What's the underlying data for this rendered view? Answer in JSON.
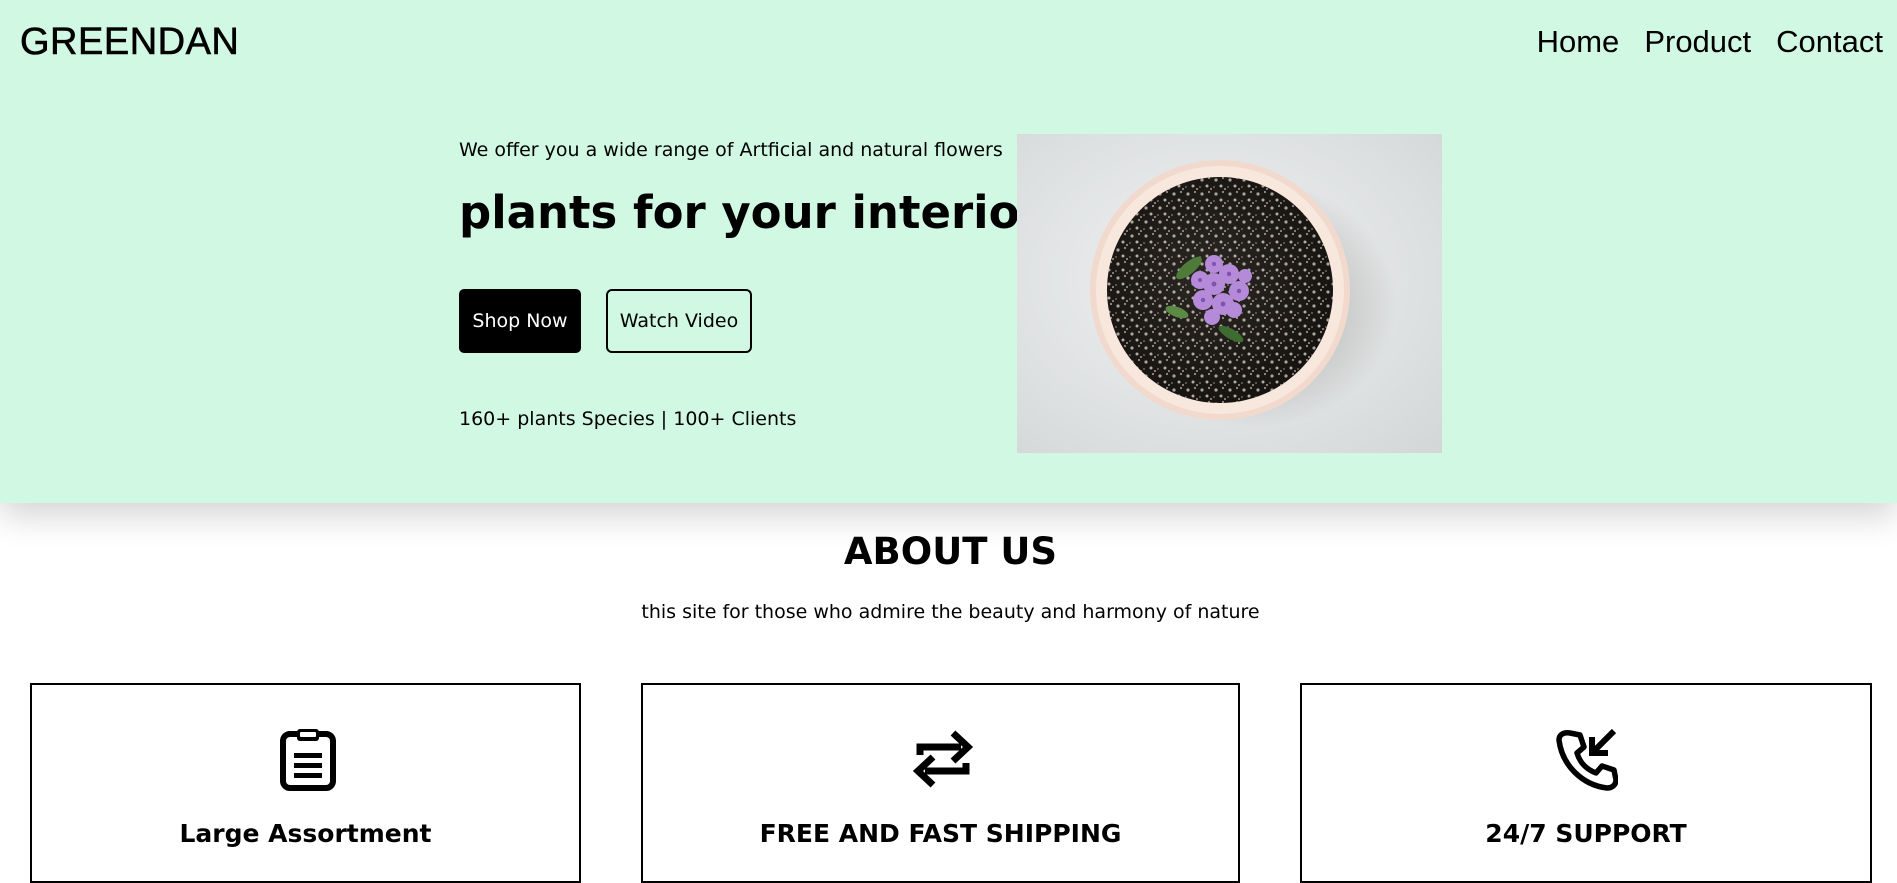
{
  "navbar": {
    "brand": "GREENDAN",
    "links": [
      "Home",
      "Product",
      "Contact"
    ],
    "background": "#d1f8e3"
  },
  "hero": {
    "tagline": "We offer you a wide range of Artficial and natural flowers",
    "title": "plants for your interior",
    "shop_button": "Shop Now",
    "watch_button": "Watch Video",
    "stats": "160+ plants Species | 100+ Clients",
    "image": "potted-purple-flower-photo"
  },
  "about": {
    "title": "ABOUT US",
    "subtitle": "this site for those who admire the beauty and harmony of nature"
  },
  "features": [
    {
      "icon": "clipboard-icon",
      "title": "Large Assortment"
    },
    {
      "icon": "repeat-arrows-icon",
      "title": "FREE AND FAST SHIPPING"
    },
    {
      "icon": "phone-incoming-icon",
      "title": "24/7 SUPPORT"
    }
  ]
}
